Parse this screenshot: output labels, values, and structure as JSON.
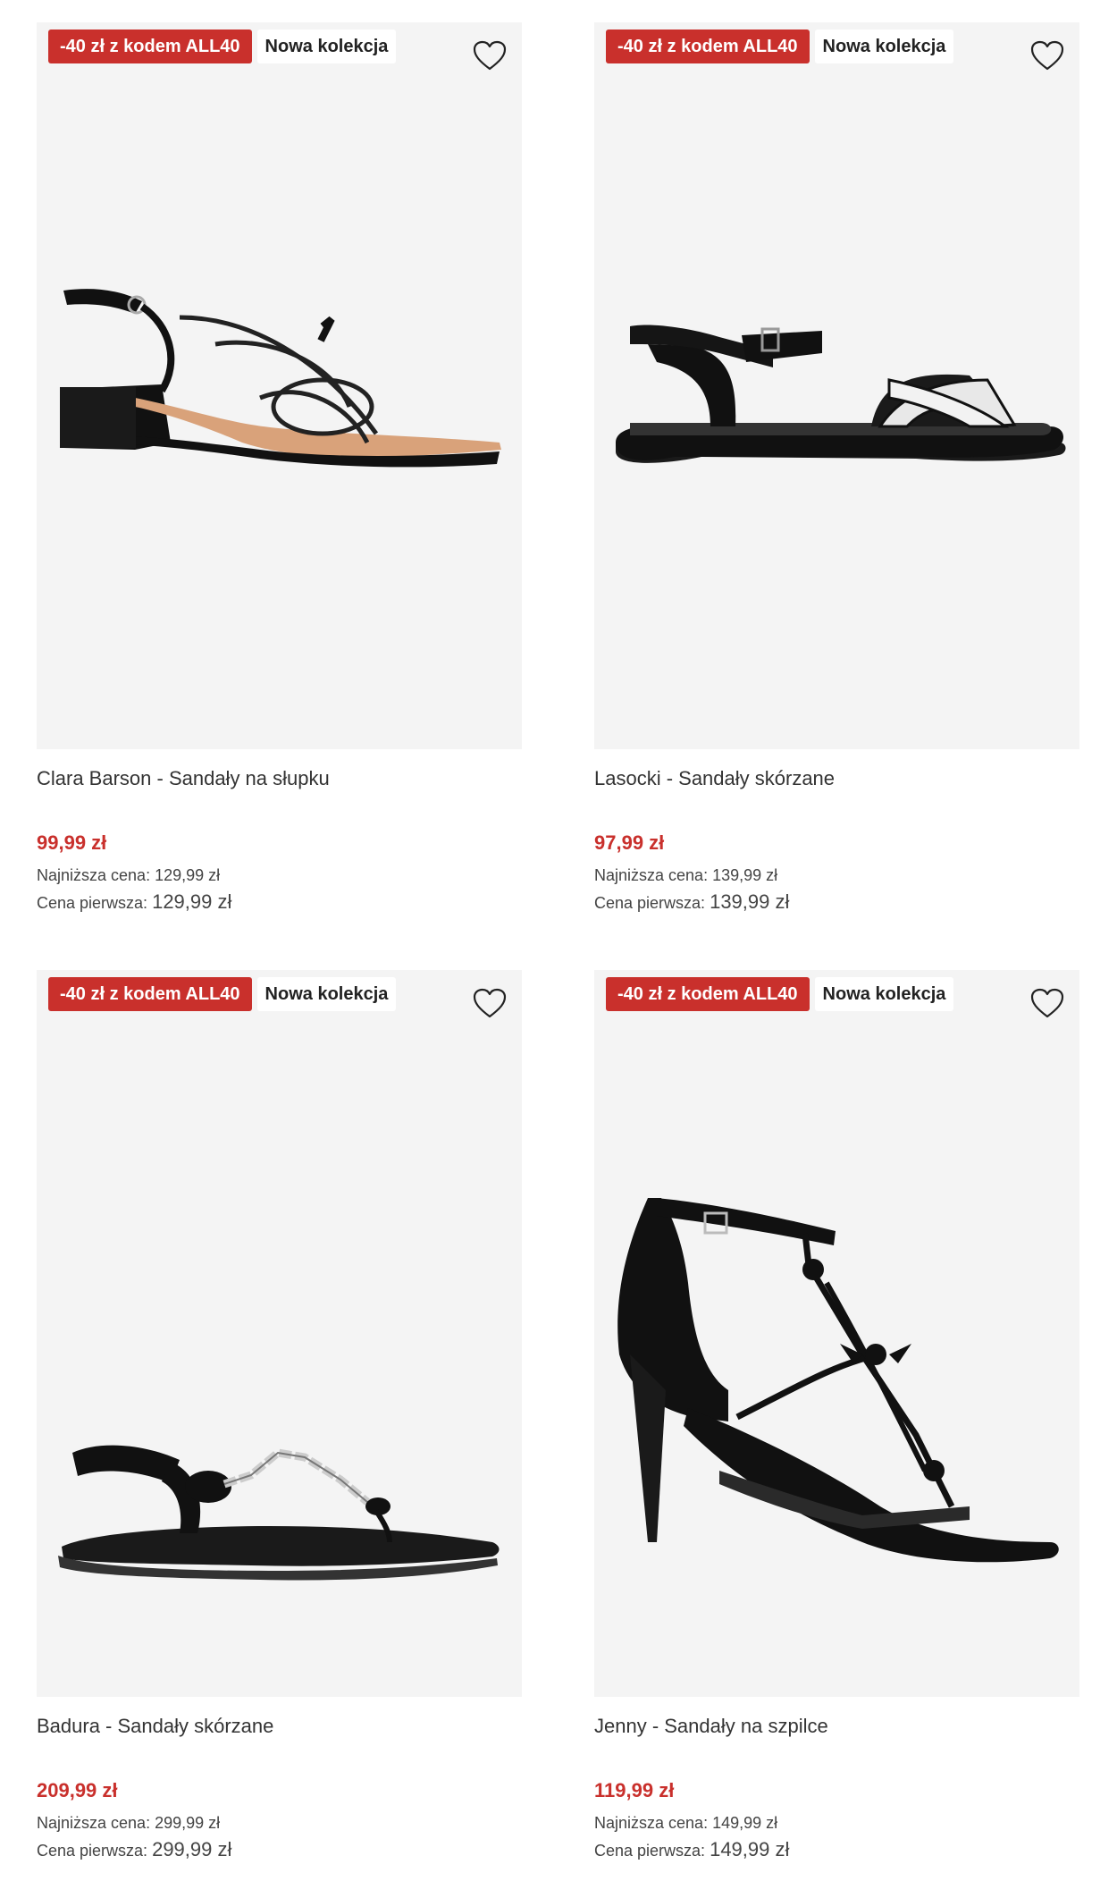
{
  "products": [
    {
      "promo_badge": "-40 zł z kodem ALL40",
      "new_badge": "Nowa kolekcja",
      "title": "Clara Barson - Sandały na słupku",
      "price": "99,99 zł",
      "lowest_label": "Najniższa cena:",
      "lowest_value": "129,99 zł",
      "first_label": "Cena pierwsza:",
      "first_value": "129,99 zł",
      "image": "black-block-heel-strappy-sandal"
    },
    {
      "promo_badge": "-40 zł z kodem ALL40",
      "new_badge": "Nowa kolekcja",
      "title": "Lasocki - Sandały skórzane",
      "price": "97,99 zł",
      "lowest_label": "Najniższa cena:",
      "lowest_value": "139,99 zł",
      "first_label": "Cena pierwsza:",
      "first_value": "139,99 zł",
      "image": "black-white-flat-leather-sandal"
    },
    {
      "promo_badge": "-40 zł z kodem ALL40",
      "new_badge": "Nowa kolekcja",
      "title": "Badura - Sandały skórzane",
      "price": "209,99 zł",
      "lowest_label": "Najniższa cena:",
      "lowest_value": "299,99 zł",
      "first_label": "Cena pierwsza:",
      "first_value": "299,99 zł",
      "image": "black-flat-jeweled-thong-sandal"
    },
    {
      "promo_badge": "-40 zł z kodem ALL40",
      "new_badge": "Nowa kolekcja",
      "title": "Jenny - Sandały na szpilce",
      "price": "119,99 zł",
      "lowest_label": "Najniższa cena:",
      "lowest_value": "149,99 zł",
      "first_label": "Cena pierwsza:",
      "first_value": "149,99 zł",
      "image": "black-stiletto-bow-sandal"
    }
  ],
  "icons": {
    "wishlist": "heart-outline-icon"
  },
  "colors": {
    "promo": "#c9302c",
    "price": "#c9302c",
    "image_bg": "#f4f4f4"
  }
}
